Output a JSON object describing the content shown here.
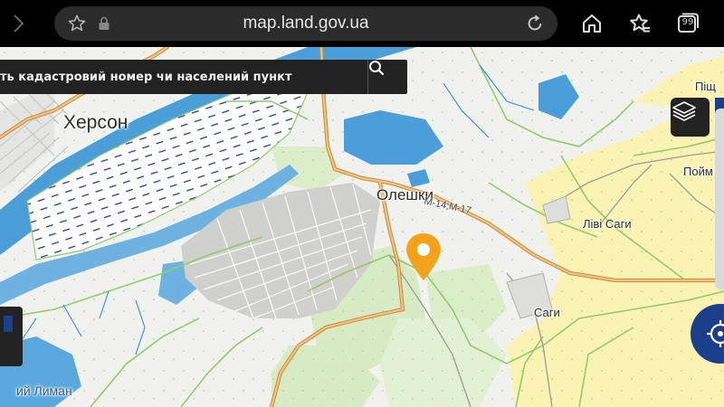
{
  "browser": {
    "url": "map.land.gov.ua",
    "tab_count": "99"
  },
  "search": {
    "placeholder": "ть кадастровий номер чи населений пункт"
  },
  "map": {
    "places": {
      "kherson": "Херсон",
      "oleshky": "Олешки",
      "livi_sagy": "Ліві Саги",
      "sagy": "Саги",
      "poim": "Пойм",
      "pisch": "Піщ",
      "lyman": "ий Лиман"
    },
    "road_label": "М-14;М-17"
  },
  "icons": {
    "back": "chevron-right-icon",
    "favorite": "star-icon",
    "lock": "lock-icon",
    "reload": "reload-icon",
    "home": "home-icon",
    "favorites": "favorites-icon",
    "tabs": "tabs-icon",
    "search": "search-icon",
    "layers": "layers-icon",
    "locate": "crosshair-icon",
    "marker": "location-pin-icon"
  },
  "colors": {
    "water": "#4a9fd8",
    "marsh_lines": "#1f3b8a",
    "road_major": "#d59a4f",
    "boundary": "#8fcc6a",
    "forest": "#d8ebc4",
    "farmland": "#fbf3b4",
    "marker": "#f2a21b",
    "accent": "#1c3f8c"
  }
}
